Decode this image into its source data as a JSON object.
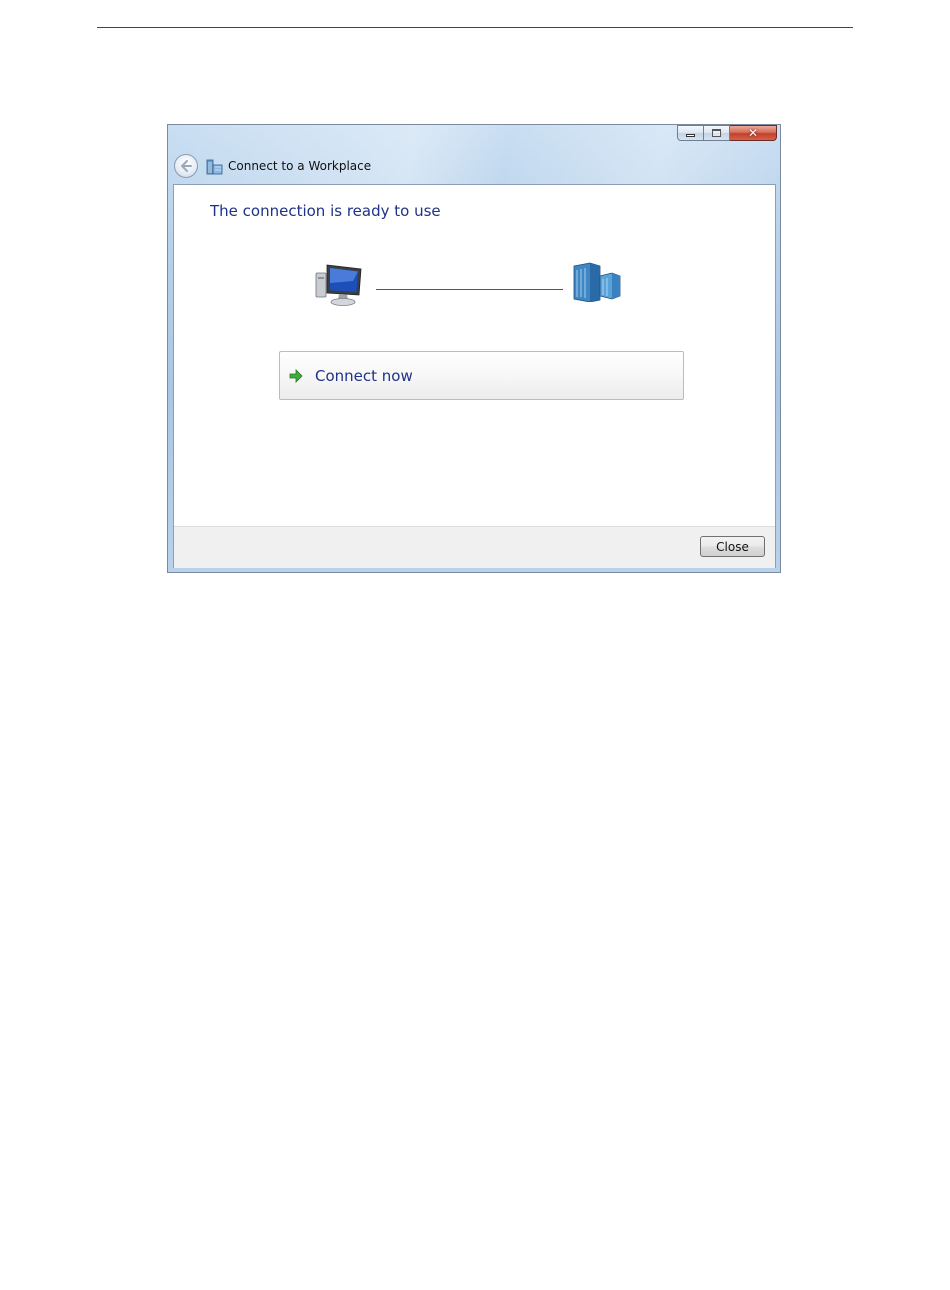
{
  "window": {
    "title": "Connect to a Workplace",
    "caption_buttons": [
      "minimize",
      "maximize",
      "close"
    ]
  },
  "content": {
    "heading": "The connection is ready to use",
    "diagram": {
      "left_icon": "computer-icon",
      "right_icon": "workplace-building-icon"
    },
    "connect_now_label": "Connect now"
  },
  "footer": {
    "close_label": "Close"
  },
  "colors": {
    "heading_text": "#1e3287",
    "frame_glass": "#b5d0eb",
    "close_caption": "#c3402a"
  }
}
